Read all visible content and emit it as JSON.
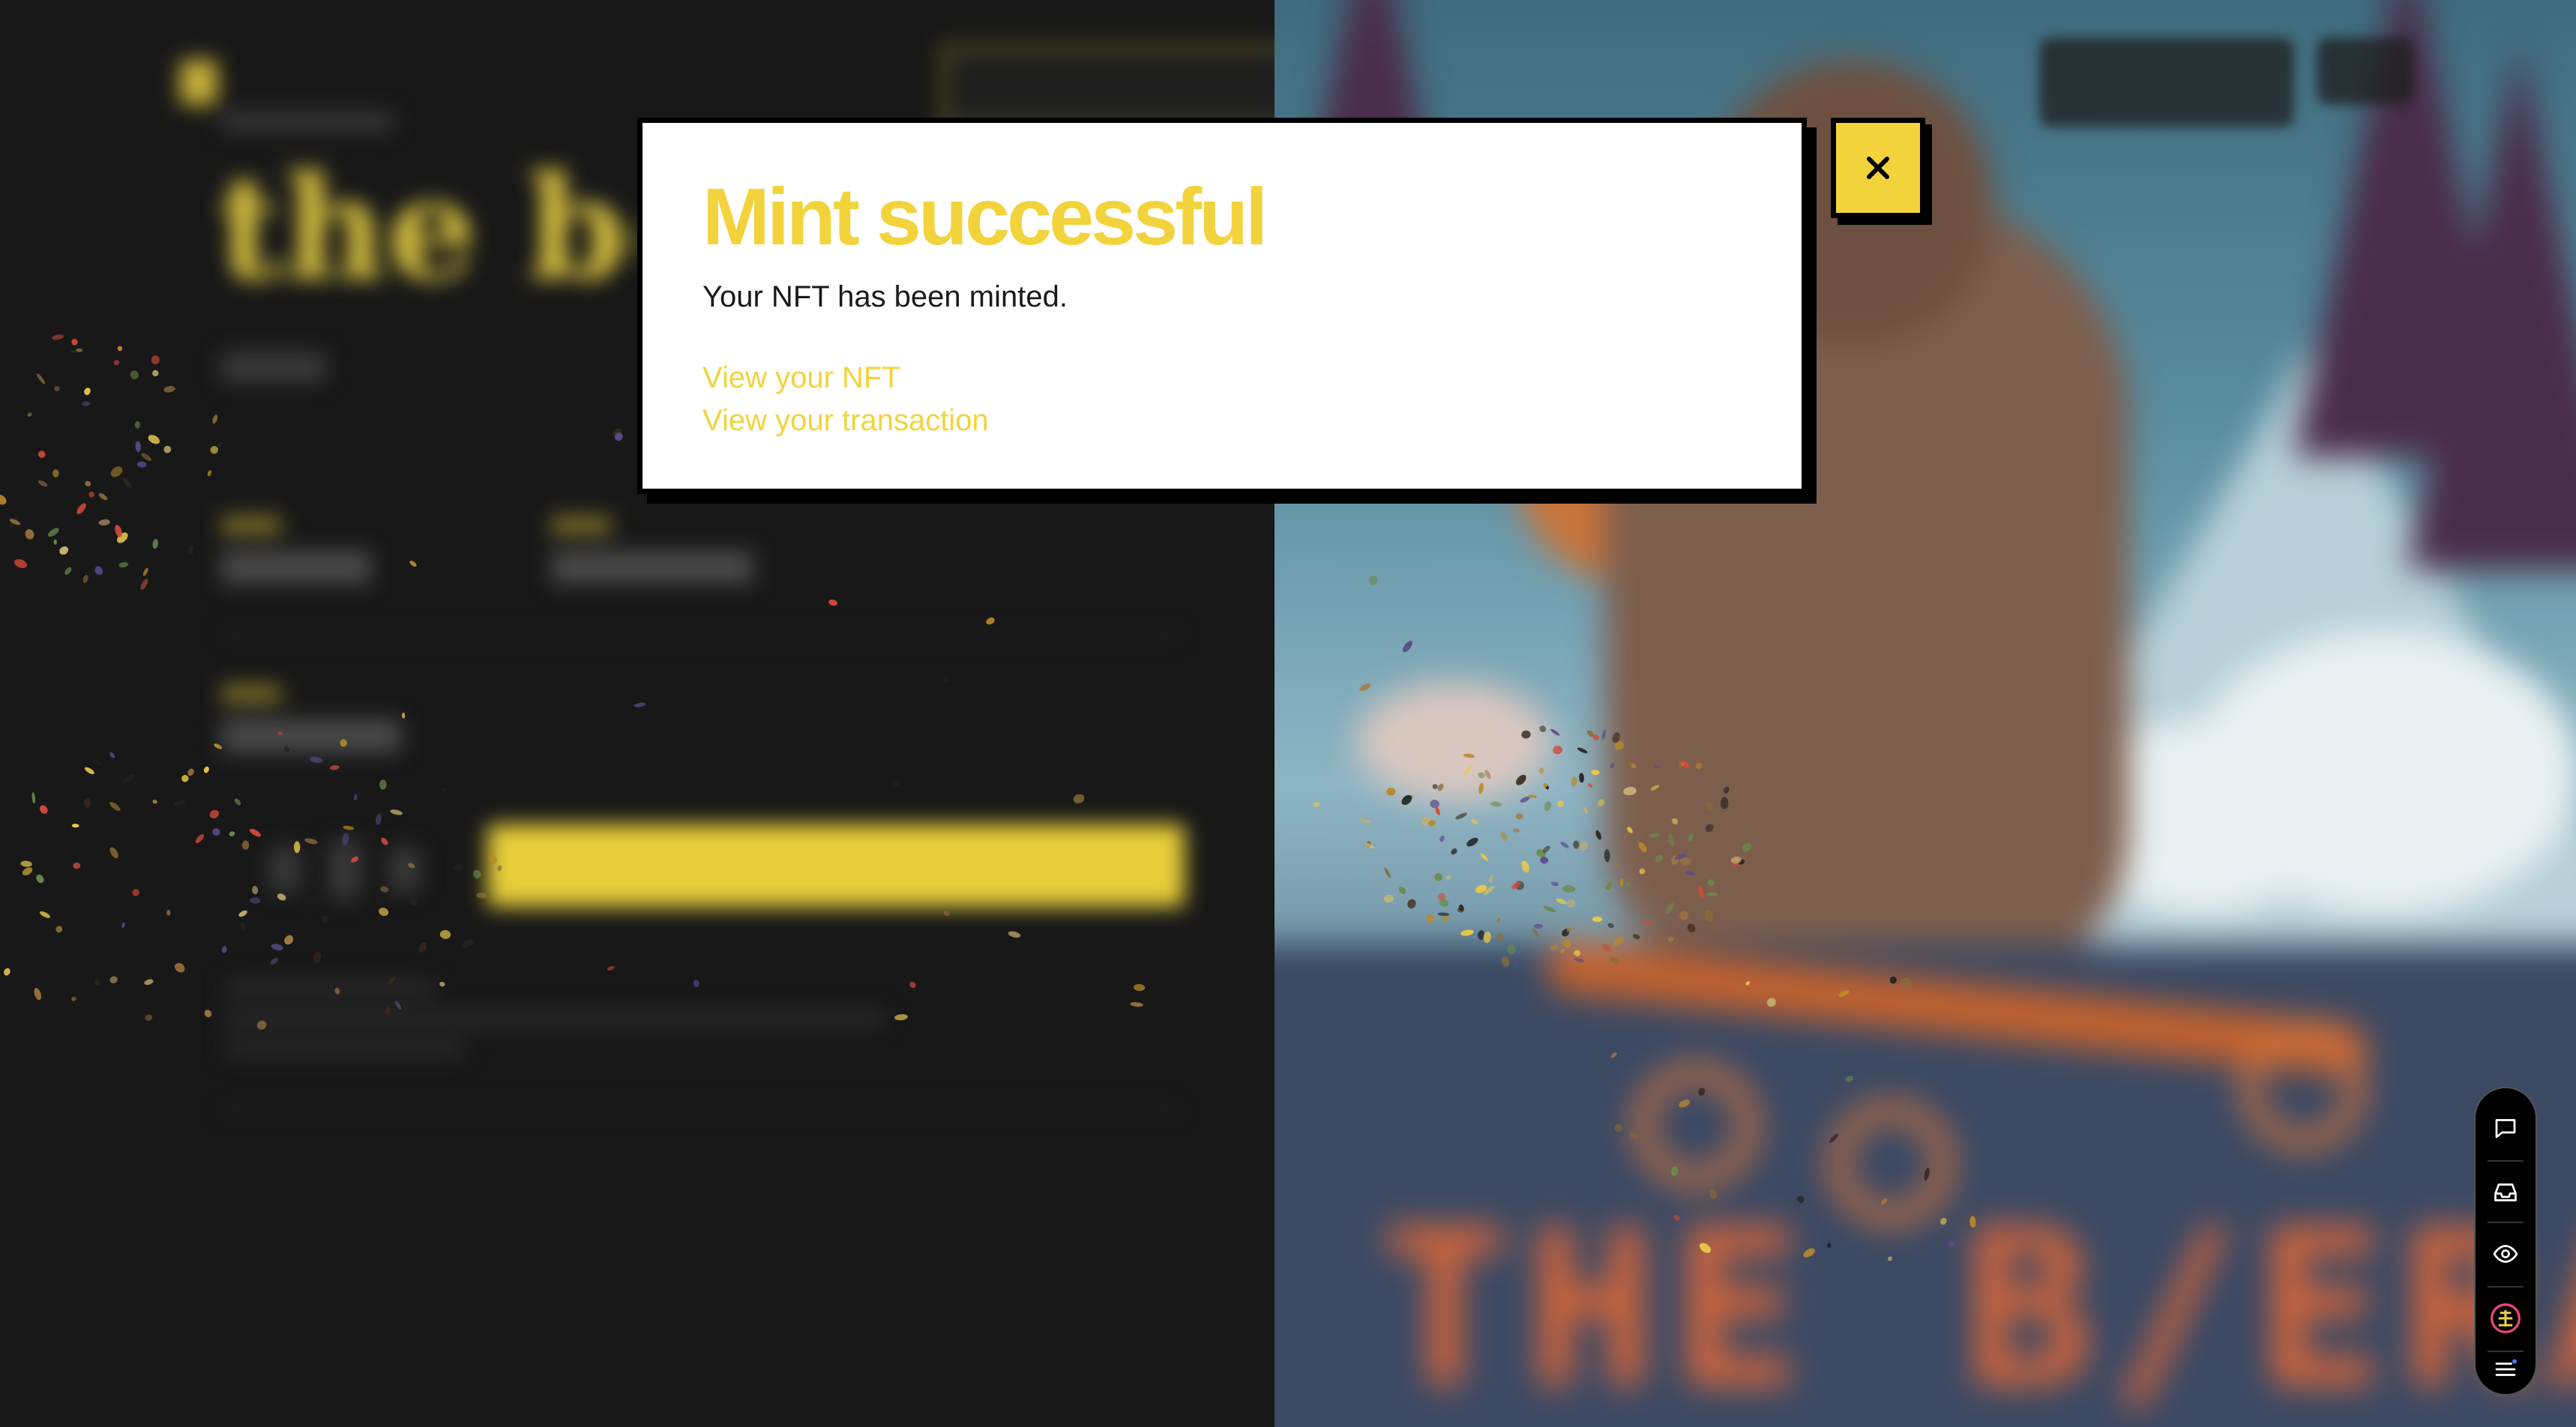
{
  "modal": {
    "title": "Mint successful",
    "message": "Your NFT has been minted.",
    "links": [
      {
        "label": "View your NFT"
      },
      {
        "label": "View your transaction"
      }
    ],
    "close_label": "×"
  },
  "colors": {
    "accent": "#f2d33c",
    "modal_bg": "#ffffff",
    "border": "#000000",
    "page_bg": "#141414"
  },
  "side_toolbar": {
    "items": [
      {
        "icon": "chat-icon"
      },
      {
        "icon": "inbox-icon"
      },
      {
        "icon": "eye-icon"
      },
      {
        "icon": "brand-icon"
      },
      {
        "icon": "menu-icon"
      }
    ]
  },
  "background": {
    "state": "blurred",
    "artwork_text": "THE B/ERA"
  }
}
